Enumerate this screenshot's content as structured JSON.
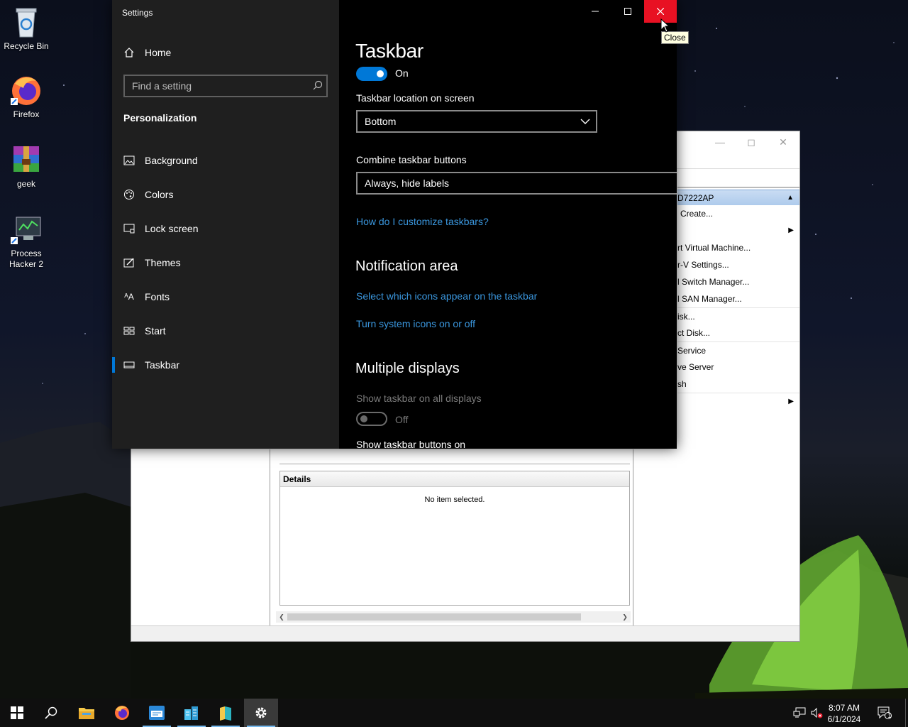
{
  "desktop": {
    "icons": [
      {
        "label": "Recycle Bin"
      },
      {
        "label": "Firefox"
      },
      {
        "label": "geek"
      },
      {
        "label": "Process Hacker 2"
      }
    ]
  },
  "hyperv": {
    "actions_header": "D7222AP",
    "actions": [
      "Create...",
      "",
      "rt Virtual Machine...",
      "r-V Settings...",
      "l Switch Manager...",
      "l SAN Manager...",
      "isk...",
      "ct Disk...",
      "Service",
      "ve Server",
      "sh",
      ""
    ],
    "details_title": "Details",
    "details_empty": "No item selected."
  },
  "settings": {
    "window_title": "Settings",
    "home_label": "Home",
    "search_placeholder": "Find a setting",
    "section_label": "Personalization",
    "nav_items": [
      {
        "label": "Background",
        "icon": "picture-icon"
      },
      {
        "label": "Colors",
        "icon": "palette-icon"
      },
      {
        "label": "Lock screen",
        "icon": "lock-screen-icon"
      },
      {
        "label": "Themes",
        "icon": "themes-icon"
      },
      {
        "label": "Fonts",
        "icon": "fonts-icon"
      },
      {
        "label": "Start",
        "icon": "start-icon"
      },
      {
        "label": "Taskbar",
        "icon": "taskbar-icon",
        "active": true
      }
    ],
    "page_title": "Taskbar",
    "top_toggle_state": "On",
    "location_label": "Taskbar location on screen",
    "location_value": "Bottom",
    "combine_label": "Combine taskbar buttons",
    "combine_value": "Always, hide labels",
    "customize_link": "How do I customize taskbars?",
    "notification_heading": "Notification area",
    "notif_link_1": "Select which icons appear on the taskbar",
    "notif_link_2": "Turn system icons on or off",
    "multi_heading": "Multiple displays",
    "show_all_label": "Show taskbar on all displays",
    "show_all_state": "Off",
    "show_buttons_label": "Show taskbar buttons on"
  },
  "tooltip": "Close",
  "taskbar": {
    "time": "8:07 AM",
    "date": "6/1/2024",
    "notification_count": "1"
  },
  "colors": {
    "accent": "#0078d7",
    "link": "#3a96dd",
    "close_red": "#e81123"
  }
}
